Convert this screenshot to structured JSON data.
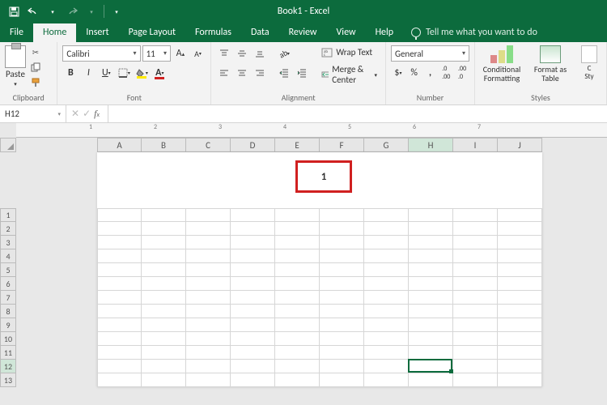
{
  "title": "Book1 - Excel",
  "tabs": [
    "File",
    "Home",
    "Insert",
    "Page Layout",
    "Formulas",
    "Data",
    "Review",
    "View",
    "Help"
  ],
  "active_tab": 1,
  "tellme": "Tell me what you want to do",
  "ribbon": {
    "clipboard": {
      "paste": "Paste",
      "label": "Clipboard"
    },
    "font": {
      "name": "Calibri",
      "size": "11",
      "label": "Font"
    },
    "alignment": {
      "wrap": "Wrap Text",
      "merge": "Merge & Center",
      "label": "Alignment"
    },
    "number": {
      "format": "General",
      "label": "Number"
    },
    "styles": {
      "cond": "Conditional Formatting",
      "table": "Format as Table",
      "cell": "Cell Styles",
      "label": "Styles"
    }
  },
  "namebox": "H12",
  "formula": "",
  "columns": [
    "A",
    "B",
    "C",
    "D",
    "E",
    "F",
    "G",
    "H",
    "I",
    "J"
  ],
  "rows": [
    "1",
    "2",
    "3",
    "4",
    "5",
    "6",
    "7",
    "8",
    "9",
    "10",
    "11",
    "12",
    "13"
  ],
  "selected_col": 7,
  "selected_row": 11,
  "page_number": "1",
  "ruler_ticks": [
    "1",
    "2",
    "3",
    "4",
    "5",
    "6",
    "7"
  ]
}
